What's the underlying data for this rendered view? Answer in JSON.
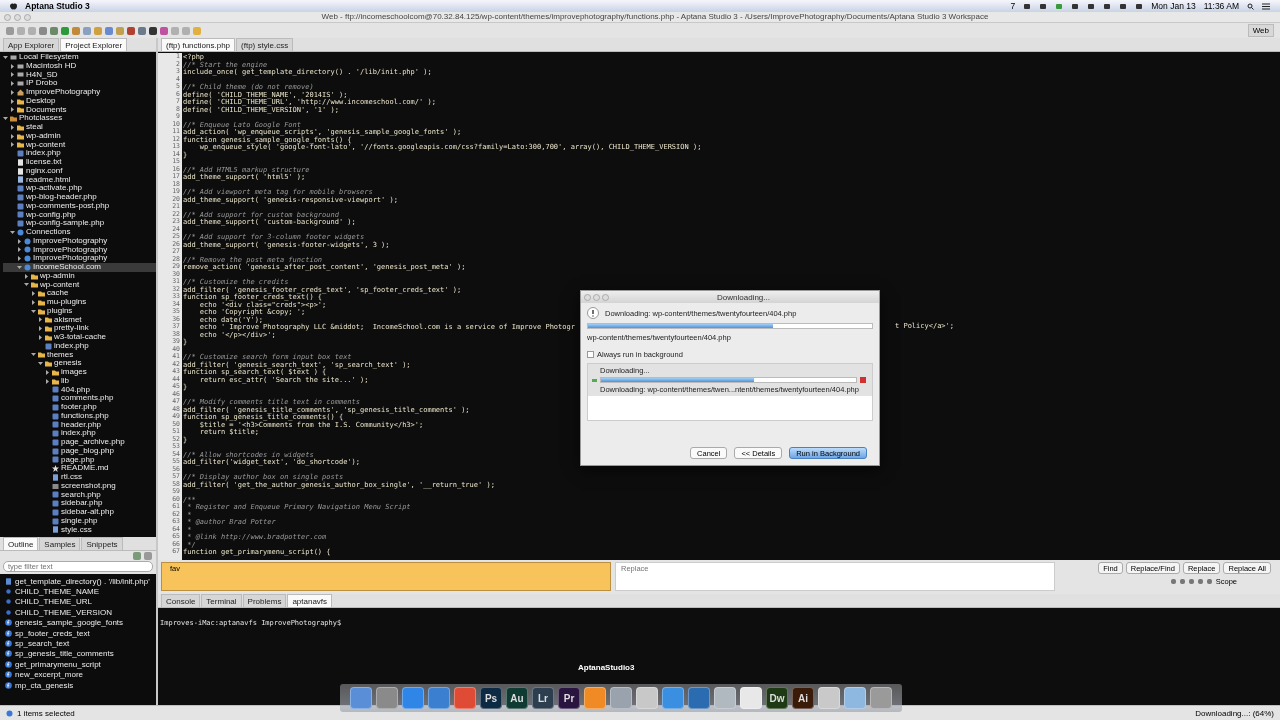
{
  "menubar": {
    "app": "Aptana Studio 3",
    "adobe_count": "7",
    "date": "Mon Jan 13",
    "time": "11:36 AM"
  },
  "window": {
    "title": "Web - ftp://incomeschoolcom@70.32.84.125/wp-content/themes/improvephotography/functions.php - Aptana Studio 3 - /Users/ImprovePhotography/Documents/Aptana Studio 3 Workspace",
    "perspective": "Web"
  },
  "explorer_tabs": [
    {
      "label": "App Explorer",
      "selected": false
    },
    {
      "label": "Project Explorer",
      "selected": true
    }
  ],
  "tree": [
    {
      "label": "Local Filesystem",
      "kind": "drive",
      "expanded": true,
      "selected": false,
      "children": [
        {
          "label": "Macintosh HD",
          "kind": "drive",
          "expanded": false,
          "selected": false
        },
        {
          "label": "H4N_SD",
          "kind": "drive",
          "expanded": false,
          "selected": false
        },
        {
          "label": "IP Drobo",
          "kind": "drive",
          "expanded": false,
          "selected": false
        },
        {
          "label": "ImprovePhotography",
          "kind": "home",
          "expanded": false,
          "selected": false
        },
        {
          "label": "Desktop",
          "kind": "folder",
          "expanded": false,
          "selected": false
        },
        {
          "label": "Documents",
          "kind": "folder",
          "expanded": false,
          "selected": false
        }
      ]
    },
    {
      "label": "Photclasses",
      "kind": "project",
      "expanded": true,
      "selected": false,
      "children": [
        {
          "label": "steal",
          "kind": "folder",
          "expanded": false,
          "selected": false
        },
        {
          "label": "wp-admin",
          "kind": "folder",
          "expanded": false,
          "selected": false
        },
        {
          "label": "wp-content",
          "kind": "folder",
          "expanded": false,
          "selected": false
        },
        {
          "label": "index.php",
          "kind": "php",
          "selected": false
        },
        {
          "label": "license.txt",
          "kind": "text",
          "selected": false
        },
        {
          "label": "nginx.conf",
          "kind": "text",
          "selected": false
        },
        {
          "label": "readme.html",
          "kind": "html",
          "selected": false
        },
        {
          "label": "wp-activate.php",
          "kind": "php",
          "selected": false
        },
        {
          "label": "wp-blog-header.php",
          "kind": "php",
          "selected": false
        },
        {
          "label": "wp-comments-post.php",
          "kind": "php",
          "selected": false
        },
        {
          "label": "wp-config.php",
          "kind": "php",
          "selected": false
        },
        {
          "label": "wp-config-sample.php",
          "kind": "php",
          "selected": false
        },
        {
          "label": "Connections",
          "kind": "server",
          "expanded": true,
          "selected": false,
          "children": [
            {
              "label": "ImprovePhotography",
              "kind": "server",
              "expanded": false,
              "selected": false
            },
            {
              "label": "ImprovePhotography",
              "kind": "server",
              "expanded": false,
              "selected": false
            },
            {
              "label": "ImprovePhotography",
              "kind": "server",
              "expanded": false,
              "selected": false
            },
            {
              "label": "IncomeSchool.com",
              "kind": "server",
              "expanded": true,
              "selected": true,
              "children": [
                {
                  "label": "wp-admin",
                  "kind": "folder",
                  "expanded": false,
                  "selected": false
                },
                {
                  "label": "wp-content",
                  "kind": "folder",
                  "expanded": true,
                  "selected": false,
                  "children": [
                    {
                      "label": "cache",
                      "kind": "folder",
                      "expanded": false,
                      "selected": false
                    },
                    {
                      "label": "mu-plugins",
                      "kind": "folder",
                      "expanded": false,
                      "selected": false
                    },
                    {
                      "label": "plugins",
                      "kind": "folder",
                      "expanded": true,
                      "selected": false,
                      "children": [
                        {
                          "label": "akismet",
                          "kind": "folder",
                          "expanded": false,
                          "selected": false
                        },
                        {
                          "label": "pretty-link",
                          "kind": "folder",
                          "expanded": false,
                          "selected": false
                        },
                        {
                          "label": "w3-total-cache",
                          "kind": "folder",
                          "expanded": false,
                          "selected": false
                        },
                        {
                          "label": "index.php",
                          "kind": "php",
                          "selected": false
                        }
                      ]
                    },
                    {
                      "label": "themes",
                      "kind": "folder",
                      "expanded": true,
                      "selected": false,
                      "children": [
                        {
                          "label": "genesis",
                          "kind": "folder",
                          "expanded": true,
                          "selected": false,
                          "children": [
                            {
                              "label": "images",
                              "kind": "folder",
                              "expanded": false,
                              "selected": false
                            },
                            {
                              "label": "lib",
                              "kind": "folder",
                              "expanded": false,
                              "selected": false
                            },
                            {
                              "label": "404.php",
                              "kind": "php",
                              "selected": false
                            },
                            {
                              "label": "comments.php",
                              "kind": "php",
                              "selected": false
                            },
                            {
                              "label": "footer.php",
                              "kind": "php",
                              "selected": false
                            },
                            {
                              "label": "functions.php",
                              "kind": "php",
                              "selected": false
                            },
                            {
                              "label": "header.php",
                              "kind": "php",
                              "selected": false
                            },
                            {
                              "label": "index.php",
                              "kind": "php",
                              "selected": false
                            },
                            {
                              "label": "page_archive.php",
                              "kind": "php",
                              "selected": false
                            },
                            {
                              "label": "page_blog.php",
                              "kind": "php",
                              "selected": false
                            },
                            {
                              "label": "page.php",
                              "kind": "php",
                              "selected": false
                            },
                            {
                              "label": "README.md",
                              "kind": "star",
                              "selected": false
                            },
                            {
                              "label": "rtl.css",
                              "kind": "css",
                              "selected": false
                            },
                            {
                              "label": "screenshot.png",
                              "kind": "image",
                              "selected": false
                            },
                            {
                              "label": "search.php",
                              "kind": "php",
                              "selected": false
                            },
                            {
                              "label": "sidebar.php",
                              "kind": "php",
                              "selected": false
                            },
                            {
                              "label": "sidebar-alt.php",
                              "kind": "php",
                              "selected": false
                            },
                            {
                              "label": "single.php",
                              "kind": "php",
                              "selected": false
                            },
                            {
                              "label": "style.css",
                              "kind": "css",
                              "selected": false
                            }
                          ]
                        }
                      ]
                    }
                  ]
                }
              ]
            }
          ]
        }
      ]
    }
  ],
  "outline_tabs": [
    {
      "label": "Outline",
      "selected": true
    },
    {
      "label": "Samples",
      "selected": false
    },
    {
      "label": "Snippets",
      "selected": false
    }
  ],
  "outline_filter": {
    "placeholder": "type filter text"
  },
  "outline": [
    {
      "label": "get_template_directory() . '/lib/init.php'",
      "kind": "include"
    },
    {
      "label": "CHILD_THEME_NAME",
      "kind": "constant"
    },
    {
      "label": "CHILD_THEME_URL",
      "kind": "constant"
    },
    {
      "label": "CHILD_THEME_VERSION",
      "kind": "constant"
    },
    {
      "label": "genesis_sample_google_fonts",
      "kind": "function"
    },
    {
      "label": "sp_footer_creds_text",
      "kind": "function"
    },
    {
      "label": "sp_search_text",
      "kind": "function"
    },
    {
      "label": "sp_genesis_title_comments",
      "kind": "function"
    },
    {
      "label": "get_primarymenu_script",
      "kind": "function"
    },
    {
      "label": "new_excerpt_more",
      "kind": "function"
    },
    {
      "label": "mp_cta_genesis",
      "kind": "function"
    }
  ],
  "editor_tabs": [
    {
      "label": "(ftp) functions.php",
      "selected": true
    },
    {
      "label": "(ftp) style.css",
      "selected": false
    }
  ],
  "code": [
    {
      "n": "1",
      "kind": "code",
      "text": "<?php"
    },
    {
      "n": "2",
      "kind": "comment",
      "text": "//* Start the engine"
    },
    {
      "n": "3",
      "kind": "code",
      "text": "include_once( get_template_directory() . '/lib/init.php' );"
    },
    {
      "n": "4"
    },
    {
      "n": "5",
      "kind": "comment",
      "text": "//* Child theme (do not remove)"
    },
    {
      "n": "6",
      "kind": "code",
      "text": "define( 'CHILD_THEME_NAME', '2014IS' );"
    },
    {
      "n": "7",
      "kind": "code",
      "text": "define( 'CHILD_THEME_URL', 'http://www.incomeschool.com/' );"
    },
    {
      "n": "8",
      "kind": "code",
      "text": "define( 'CHILD_THEME_VERSION', '1' );"
    },
    {
      "n": "9"
    },
    {
      "n": "10",
      "kind": "comment",
      "text": "//* Enqueue Lato Google Font"
    },
    {
      "n": "11",
      "kind": "code",
      "text": "add_action( 'wp_enqueue_scripts', 'genesis_sample_google_fonts' );"
    },
    {
      "n": "12",
      "kind": "code",
      "text": "function genesis_sample_google_fonts() {"
    },
    {
      "n": "13",
      "kind": "code",
      "text": "    wp_enqueue_style( 'google-font-lato', '//fonts.googleapis.com/css?family=Lato:300,700', array(), CHILD_THEME_VERSION );"
    },
    {
      "n": "14",
      "kind": "code",
      "text": "}"
    },
    {
      "n": "15"
    },
    {
      "n": "16",
      "kind": "comment",
      "text": "//* Add HTML5 markup structure"
    },
    {
      "n": "17",
      "kind": "code",
      "text": "add_theme_support( 'html5' );"
    },
    {
      "n": "18"
    },
    {
      "n": "19",
      "kind": "comment",
      "text": "//* Add viewport meta tag for mobile browsers"
    },
    {
      "n": "20",
      "kind": "code",
      "text": "add_theme_support( 'genesis-responsive-viewport' );"
    },
    {
      "n": "21"
    },
    {
      "n": "22",
      "kind": "comment",
      "text": "//* Add support for custom background"
    },
    {
      "n": "23",
      "kind": "code",
      "text": "add_theme_support( 'custom-background' );"
    },
    {
      "n": "24"
    },
    {
      "n": "25",
      "kind": "comment",
      "text": "//* Add support for 3-column footer widgets"
    },
    {
      "n": "26",
      "kind": "code",
      "text": "add_theme_support( 'genesis-footer-widgets', 3 );"
    },
    {
      "n": "27"
    },
    {
      "n": "28",
      "kind": "comment",
      "text": "//* Remove the post meta function"
    },
    {
      "n": "29",
      "kind": "code",
      "text": "remove_action( 'genesis_after_post_content', 'genesis_post_meta' );"
    },
    {
      "n": "30"
    },
    {
      "n": "31",
      "kind": "comment",
      "text": "//* Customize the credits"
    },
    {
      "n": "32",
      "kind": "code",
      "text": "add_filter( 'genesis_footer_creds_text', 'sp_footer_creds_text' );"
    },
    {
      "n": "33",
      "kind": "code",
      "text": "function sp_footer_creds_text() {"
    },
    {
      "n": "34",
      "kind": "code",
      "text": "    echo '<div class=\"creds\"><p>';"
    },
    {
      "n": "35",
      "kind": "code",
      "text": "    echo 'Copyright &copy; ';"
    },
    {
      "n": "36",
      "kind": "code",
      "text": "    echo date('Y');"
    },
    {
      "n": "37",
      "kind": "code",
      "text": "    echo ' Improve Photography LLC &middot;  IncomeSchool.com is a service of Improve Photogr",
      "tail": "t Policy</a>';"
    },
    {
      "n": "38",
      "kind": "code",
      "text": "    echo '</p></div>';"
    },
    {
      "n": "39",
      "kind": "code",
      "text": "}"
    },
    {
      "n": "40"
    },
    {
      "n": "41",
      "kind": "comment",
      "text": "//* Customize search form input box text"
    },
    {
      "n": "42",
      "kind": "code",
      "text": "add_filter( 'genesis_search_text', 'sp_search_text' );"
    },
    {
      "n": "43",
      "kind": "code",
      "text": "function sp_search_text( $text ) {"
    },
    {
      "n": "44",
      "kind": "code",
      "text": "    return esc_attr( 'Search the site...' );"
    },
    {
      "n": "45",
      "kind": "code",
      "text": "}"
    },
    {
      "n": "46"
    },
    {
      "n": "47",
      "kind": "comment",
      "text": "//* Modify comments title text in comments"
    },
    {
      "n": "48",
      "kind": "code",
      "text": "add_filter( 'genesis_title_comments', 'sp_genesis_title_comments' );"
    },
    {
      "n": "49",
      "kind": "code",
      "text": "function sp_genesis_title_comments() {"
    },
    {
      "n": "50",
      "kind": "code",
      "text": "    $title = '<h3>Comments from the I.S. Community</h3>';"
    },
    {
      "n": "51",
      "kind": "code",
      "text": "    return $title;"
    },
    {
      "n": "52",
      "kind": "code",
      "text": "}"
    },
    {
      "n": "53"
    },
    {
      "n": "54",
      "kind": "comment",
      "text": "//* Allow shortcodes in widgets"
    },
    {
      "n": "55",
      "kind": "code",
      "text": "add_filter('widget_text', 'do_shortcode');"
    },
    {
      "n": "56"
    },
    {
      "n": "57",
      "kind": "comment",
      "text": "//* Display author box on single posts"
    },
    {
      "n": "58",
      "kind": "code",
      "text": "add_filter( 'get_the_author_genesis_author_box_single', '__return_true' );"
    },
    {
      "n": "59"
    },
    {
      "n": "60",
      "kind": "comment",
      "text": "/**"
    },
    {
      "n": "61",
      "kind": "comment",
      "text": " * Register and Enqueue Primary Navigation Menu Script"
    },
    {
      "n": "62",
      "kind": "comment",
      "text": " *"
    },
    {
      "n": "63",
      "kind": "comment",
      "text": " * @author Brad Potter"
    },
    {
      "n": "64",
      "kind": "comment",
      "text": " *"
    },
    {
      "n": "65",
      "kind": "comment",
      "text": " * @link http://www.bradpotter.com"
    },
    {
      "n": "66",
      "kind": "comment",
      "text": " */"
    },
    {
      "n": "67",
      "kind": "code",
      "text": "function get_primarymenu_script() {"
    }
  ],
  "find": {
    "value": "fav",
    "replace_placeholder": "Replace",
    "buttons": [
      "Find",
      "Replace/Find",
      "Replace",
      "Replace All"
    ],
    "scope": "Scope"
  },
  "console_tabs": [
    {
      "label": "Console",
      "selected": false
    },
    {
      "label": "Terminal",
      "selected": false
    },
    {
      "label": "Problems",
      "selected": false
    },
    {
      "label": "aptanavfs",
      "selected": true
    }
  ],
  "console_text": "Improves-iMac:aptanavfs ImprovePhotography$",
  "dialog": {
    "title": "Downloading...",
    "message": "Downloading: wp-content/themes/twentyfourteen/404.php",
    "level": 0.65,
    "path": "wp-content/themes/twentyfourteen/404.php",
    "background_checkbox": {
      "label": "Always run in background",
      "checked": false
    },
    "job": {
      "title": "Downloading...",
      "level": 0.6,
      "detail": "Downloading: wp-content/themes/twen...ntent/themes/twentyfourteen/404.php"
    },
    "buttons": [
      {
        "label": "Cancel",
        "selected": false
      },
      {
        "label": "<< Details",
        "selected": false
      },
      {
        "label": "Run in Background",
        "selected": true
      }
    ]
  },
  "dock": {
    "label": "AptanaStudio3",
    "apps": [
      {
        "color": "#5a8fd8"
      },
      {
        "color": "#8a8a8a"
      },
      {
        "color": "#2f86e6"
      },
      {
        "color": "#3a7fd0"
      },
      {
        "color": "#e04b35"
      },
      {
        "label": "Ps",
        "color": "#0d2a45"
      },
      {
        "label": "Au",
        "color": "#0f3b33"
      },
      {
        "label": "Lr",
        "color": "#2c3e50"
      },
      {
        "label": "Pr",
        "color": "#2a1440"
      },
      {
        "color": "#f08a24"
      },
      {
        "color": "#9aa3ad"
      },
      {
        "color": "#c8c8c8"
      },
      {
        "color": "#3b8fe0"
      },
      {
        "color": "#2b6cb0"
      },
      {
        "color": "#b0b8c0"
      },
      {
        "color": "#e8e8e8"
      },
      {
        "label": "Dw",
        "color": "#1e3a14"
      },
      {
        "label": "Ai",
        "color": "#3a1a08"
      },
      {
        "color": "#c9c9c9"
      },
      {
        "color": "#8fb8e0"
      },
      {
        "color": "#9a9a9a"
      }
    ]
  },
  "status": {
    "left": "1 items selected",
    "right": "Downloading...: (64%)"
  }
}
